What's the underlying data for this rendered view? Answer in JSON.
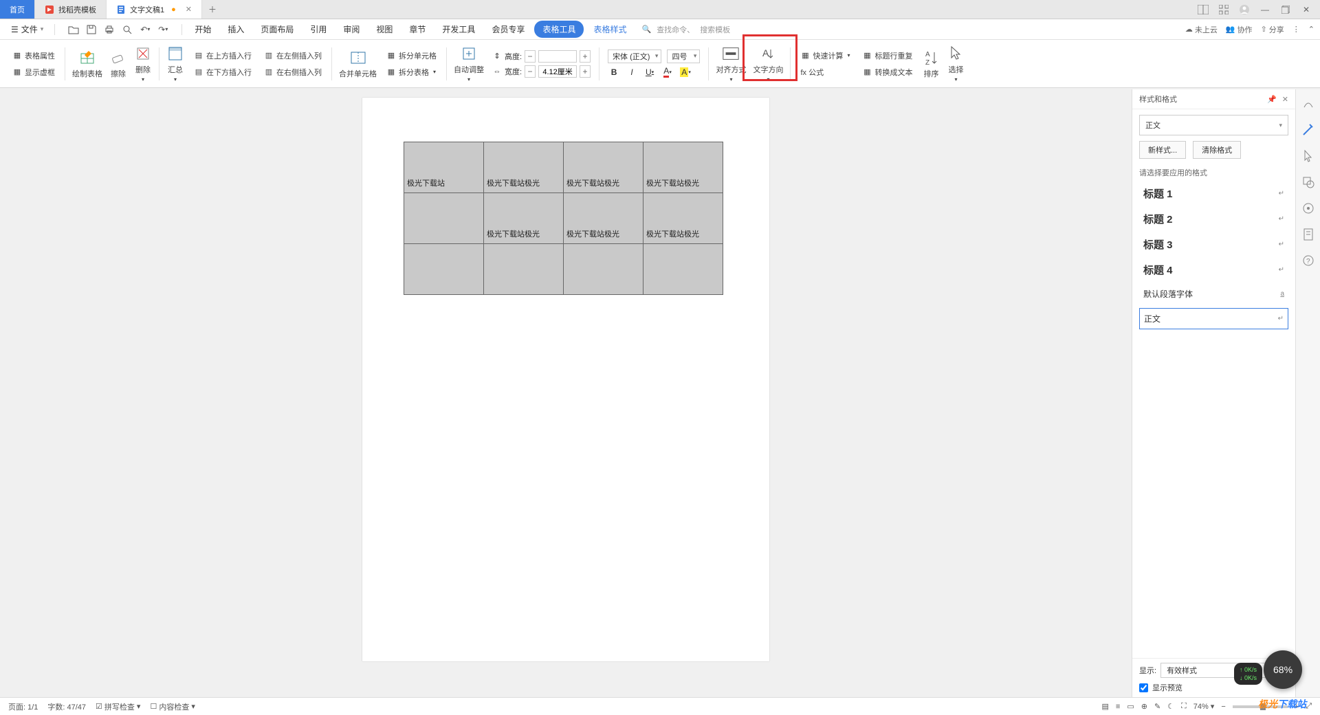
{
  "tabs": {
    "home": "首页",
    "templates": "找稻壳模板",
    "doc": "文字文稿1"
  },
  "menu": {
    "file": "文件",
    "items": [
      "开始",
      "插入",
      "页面布局",
      "引用",
      "审阅",
      "视图",
      "章节",
      "开发工具",
      "会员专享",
      "表格工具",
      "表格样式"
    ],
    "highlight_index": 9,
    "link_index": 10,
    "search_cmd": "查找命令、",
    "search_tpl": "搜索模板",
    "cloud": "未上云",
    "coop": "协作",
    "share": "分享"
  },
  "ribbon": {
    "props": "表格属性",
    "show_dashed": "显示虚框",
    "draw": "绘制表格",
    "erase": "擦除",
    "delete": "删除",
    "summary": "汇总",
    "insert_row_above": "在上方插入行",
    "insert_row_below": "在下方插入行",
    "insert_col_left": "在左侧插入列",
    "insert_col_right": "在右侧插入列",
    "merge": "合并单元格",
    "split": "拆分单元格",
    "split_table": "拆分表格",
    "autofit": "自动调整",
    "height_label": "高度:",
    "height_value": "",
    "width_label": "宽度:",
    "width_value": "4.12厘米",
    "font_name": "宋体 (正文)",
    "font_size": "四号",
    "align": "对齐方式",
    "text_dir": "文字方向",
    "quick_calc": "快速计算",
    "formula": "fx 公式",
    "header_repeat": "标题行重复",
    "to_text": "转换成文本",
    "sort": "排序",
    "select": "选择"
  },
  "table": {
    "r1": [
      "极光下载站",
      "极光下载站极光",
      "极光下载站极光",
      "极光下载站极光"
    ],
    "r2": [
      "",
      "极光下载站极光",
      "极光下载站极光",
      "极光下载站极光"
    ],
    "r3": [
      "",
      "",
      "",
      ""
    ]
  },
  "panel": {
    "title": "样式和格式",
    "current": "正文",
    "new_style": "新样式...",
    "clear_format": "清除格式",
    "prompt": "请选择要应用的格式",
    "styles": [
      "标题 1",
      "标题 2",
      "标题 3",
      "标题 4"
    ],
    "default_para": "默认段落字体",
    "selected": "正文",
    "display_label": "显示:",
    "display_value": "有效样式",
    "preview": "显示预览"
  },
  "status": {
    "page": "页面: 1/1",
    "words": "字数: 47/47",
    "spell": "拼写检查",
    "content": "内容检查",
    "zoom": "74%"
  },
  "float": {
    "pct": "68",
    "up": "0K/s",
    "down": "0K/s"
  },
  "watermark": {
    "t1": "极光",
    "t2": "下载站"
  }
}
